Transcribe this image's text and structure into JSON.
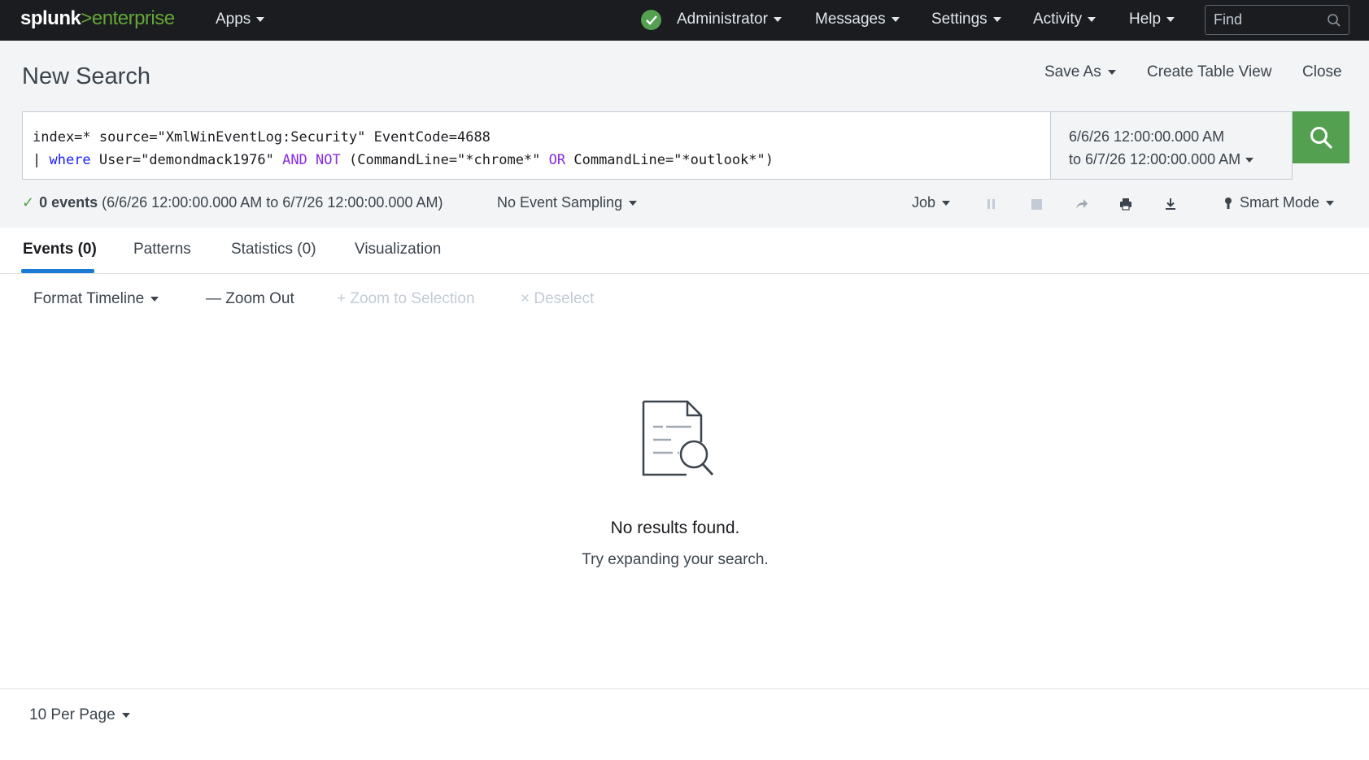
{
  "brand": {
    "part1": "splunk",
    "part2": ">",
    "part3": "enterprise"
  },
  "nav": {
    "apps": "Apps",
    "administrator": "Administrator",
    "messages": "Messages",
    "settings": "Settings",
    "activity": "Activity",
    "help": "Help",
    "find_placeholder": "Find"
  },
  "header": {
    "title": "New Search",
    "save_as": "Save As",
    "create_table_view": "Create Table View",
    "close": "Close"
  },
  "search": {
    "line1": "index=* source=\"XmlWinEventLog:Security\" EventCode=4688",
    "line2_pipe": "| ",
    "line2_where": "where",
    "line2_a": " User=\"demondmack1976\" ",
    "line2_and": "AND",
    "line2_sp": " ",
    "line2_not": "NOT",
    "line2_b": " (CommandLine=\"*chrome*\" ",
    "line2_or": "OR",
    "line2_c": " CommandLine=\"*outlook*\")"
  },
  "time_range": {
    "from": "6/6/26 12:00:00.000 AM",
    "to": "to 6/7/26 12:00:00.000 AM"
  },
  "status": {
    "count": "0 events",
    "range": " (6/6/26 12:00:00.000 AM to 6/7/26 12:00:00.000 AM)",
    "sampling": "No Event Sampling",
    "job": "Job",
    "mode": "Smart Mode"
  },
  "tabs": [
    "Events (0)",
    "Patterns",
    "Statistics (0)",
    "Visualization"
  ],
  "timeline": {
    "format": "Format Timeline",
    "zoom_out": "— Zoom Out",
    "zoom_selection": "+ Zoom to Selection",
    "deselect": "× Deselect"
  },
  "empty": {
    "title": "No results found.",
    "subtitle": "Try expanding your search."
  },
  "footer": {
    "per_page": "10 Per Page"
  },
  "colors": {
    "accent_green": "#53a051",
    "tab_active": "#1a7ad4",
    "nav_bg": "#1a1c20"
  }
}
